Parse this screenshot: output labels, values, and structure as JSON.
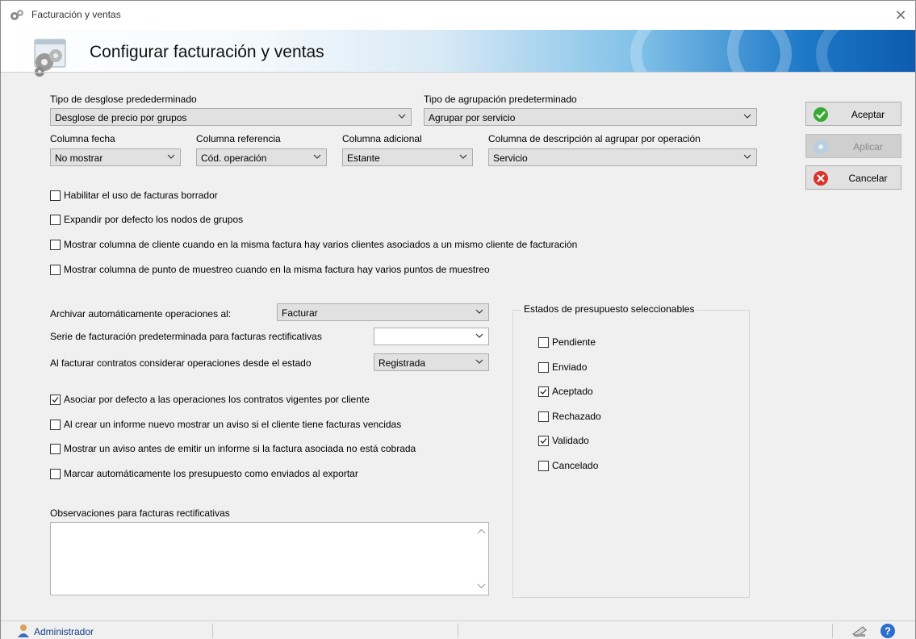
{
  "window": {
    "title": "Facturación y ventas"
  },
  "banner": {
    "title": "Configurar facturación y ventas"
  },
  "fields": {
    "desglose": {
      "label": "Tipo de desglose predederminado",
      "value": "Desglose de precio por grupos"
    },
    "agrupacion": {
      "label": "Tipo de agrupación predeterminado",
      "value": "Agrupar por servicio"
    },
    "col_fecha": {
      "label": "Columna fecha",
      "value": "No mostrar"
    },
    "col_referencia": {
      "label": "Columna referencia",
      "value": "Cód. operación"
    },
    "col_adicional": {
      "label": "Columna adicional",
      "value": "Estante"
    },
    "col_descripcion": {
      "label": "Columna de descripción al agrupar por operación",
      "value": "Servicio"
    },
    "archivar": {
      "label": "Archivar automáticamente operaciones al:",
      "value": "Facturar"
    },
    "serie": {
      "label": "Serie de facturación predeterminada para facturas rectificativas",
      "value": ""
    },
    "contratos": {
      "label": "Al facturar contratos considerar operaciones desde el estado",
      "value": "Registrada"
    },
    "observaciones": {
      "label": "Observaciones para facturas rectificativas",
      "value": ""
    }
  },
  "options_top": [
    {
      "label": "Habilitar el uso de facturas borrador",
      "checked": false
    },
    {
      "label": "Expandir por defecto los nodos de grupos",
      "checked": false
    },
    {
      "label": "Mostrar columna de cliente cuando en la misma factura hay varios clientes asociados a un mismo cliente de facturación",
      "checked": false
    },
    {
      "label": "Mostrar columna de punto de muestreo cuando en la misma factura hay varios puntos de muestreo",
      "checked": false
    }
  ],
  "options_bottom": [
    {
      "label": "Asociar por defecto a las operaciones los contratos vigentes por cliente",
      "checked": true
    },
    {
      "label": "Al crear un informe nuevo mostrar un aviso si el cliente tiene facturas vencidas",
      "checked": false
    },
    {
      "label": "Mostrar un aviso antes de emitir un informe si la factura asociada no está cobrada",
      "checked": false
    },
    {
      "label": "Marcar automáticamente los presupuesto como enviados al exportar",
      "checked": false
    }
  ],
  "estados": {
    "title": "Estados de presupuesto seleccionables",
    "items": [
      {
        "label": "Pendiente",
        "checked": false
      },
      {
        "label": "Enviado",
        "checked": false
      },
      {
        "label": "Aceptado",
        "checked": true
      },
      {
        "label": "Rechazado",
        "checked": false
      },
      {
        "label": "Validado",
        "checked": true
      },
      {
        "label": "Cancelado",
        "checked": false
      }
    ]
  },
  "buttons": {
    "aceptar": "Aceptar",
    "aplicar": "Aplicar",
    "cancelar": "Cancelar"
  },
  "status": {
    "user": "Administrador"
  },
  "colors": {
    "accept_green": "#3aa935",
    "cancel_red": "#d9322a",
    "help_blue": "#2a6fd0"
  }
}
